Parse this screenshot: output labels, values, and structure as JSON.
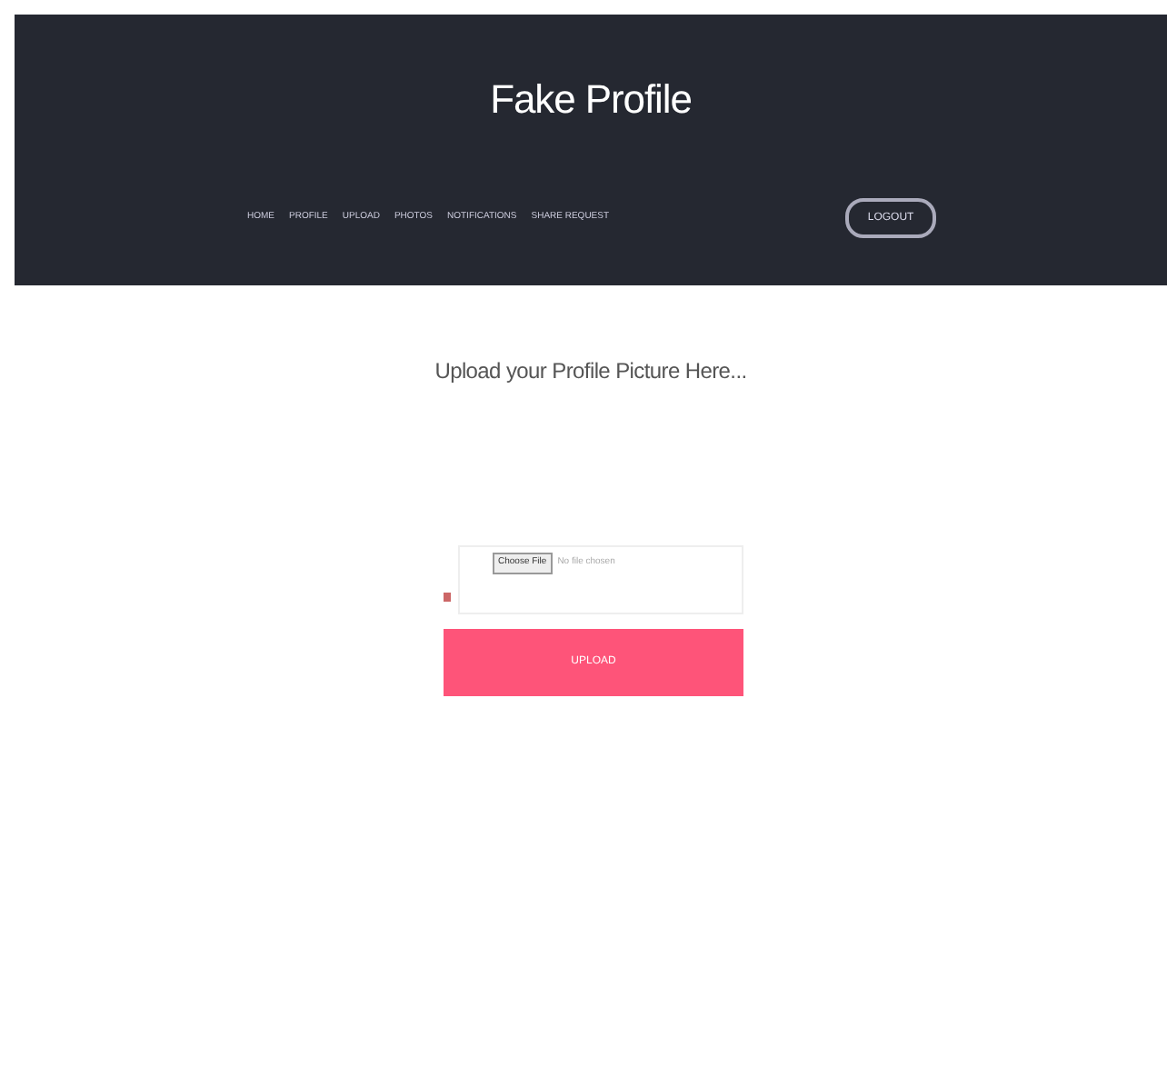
{
  "header": {
    "title": "Fake Profile",
    "nav": [
      {
        "label": "HOME"
      },
      {
        "label": "PROFILE"
      },
      {
        "label": "UPLOAD"
      },
      {
        "label": "PHOTOS"
      },
      {
        "label": "NOTIFICATIONS"
      },
      {
        "label": "SHARE REQUEST"
      }
    ],
    "logout": "LOGOUT"
  },
  "heading": "Upload your Profile Picture Here...",
  "file_input": {
    "button": "Choose File",
    "status": "No file chosen"
  },
  "submit": "UPLOAD"
}
